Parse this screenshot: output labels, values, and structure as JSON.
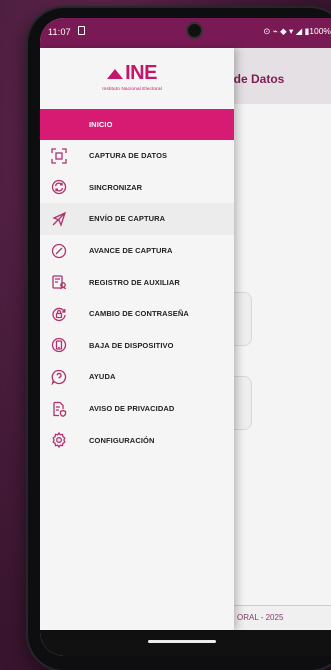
{
  "status_bar": {
    "time": "11:07",
    "icons_text": "⊙ ⌁ ◆ ▾ ◢ ▮100%"
  },
  "app_bar": {
    "title_partial": "n de Datos"
  },
  "footer": {
    "text_partial": "ORAL - 2025"
  },
  "drawer": {
    "logo": {
      "wordmark": "INE",
      "subtitle": "Instituto Nacional Electoral"
    },
    "items": [
      {
        "label": "INICIO",
        "icon": "home-icon",
        "active": true
      },
      {
        "label": "CAPTURA DE DATOS",
        "icon": "scan-icon"
      },
      {
        "label": "SINCRONIZAR",
        "icon": "sync-icon"
      },
      {
        "label": "ENVÍO DE CAPTURA",
        "icon": "send-icon"
      },
      {
        "label": "AVANCE DE CAPTURA",
        "icon": "progress-icon"
      },
      {
        "label": "REGISTRO DE AUXILIAR",
        "icon": "register-icon"
      },
      {
        "label": "CAMBIO DE CONTRASEÑA",
        "icon": "password-icon"
      },
      {
        "label": "BAJA DE DISPOSITIVO",
        "icon": "device-icon"
      },
      {
        "label": "AYUDA",
        "icon": "help-icon"
      },
      {
        "label": "AVISO DE PRIVACIDAD",
        "icon": "privacy-icon"
      },
      {
        "label": "CONFIGURACIÓN",
        "icon": "settings-icon"
      }
    ]
  },
  "colors": {
    "accent": "#d81b72",
    "brand": "#c4166a",
    "app_bar": "#7a1a55",
    "icon": "#b0316f"
  }
}
